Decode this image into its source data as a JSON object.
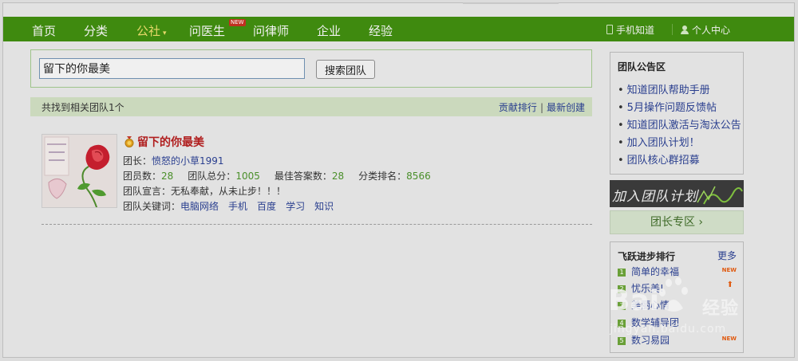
{
  "nav": {
    "items": [
      {
        "label": "首页"
      },
      {
        "label": "分类"
      },
      {
        "label": "公社"
      },
      {
        "label": "问医生"
      },
      {
        "label": "问律师"
      },
      {
        "label": "企业"
      },
      {
        "label": "经验"
      }
    ],
    "new_badge": "NEW",
    "mobile_label": "手机知道",
    "user_center_label": "个人中心",
    "active_color": "#e6d86a",
    "bar_color": "#3f8a0f"
  },
  "search": {
    "value": "留下的你最美",
    "button_label": "搜索团队"
  },
  "results": {
    "count_text": "共找到相关团队1个",
    "sort_contribution": "贡献排行",
    "sort_separator": "|",
    "sort_newest": "最新创建"
  },
  "team": {
    "name": "留下的你最美",
    "leader_label": "团长：",
    "leader_name": "愤怒的小草1991",
    "members_label": "团员数：",
    "members_value": "28",
    "score_label": "团队总分：",
    "score_value": "1005",
    "best_label": "最佳答案数：",
    "best_value": "28",
    "rank_label": "分类排名：",
    "rank_value": "8566",
    "slogan_label": "团队宣言：",
    "slogan": "无私奉献，从未止步！！！",
    "keywords_label": "团队关键词：",
    "keywords": [
      "电脑网络",
      "手机",
      "百度",
      "学习",
      "知识"
    ]
  },
  "notice": {
    "title": "团队公告区",
    "items": [
      "知道团队帮助手册",
      "5月操作问题反馈帖",
      "知道团队激活与淘汰公告",
      "加入团队计划！",
      "团队核心群招募"
    ]
  },
  "banner": {
    "text": "加入团队计划"
  },
  "leader_zone": {
    "label": "团长专区 ›"
  },
  "ranking": {
    "title": "飞跃进步排行",
    "more": "更多",
    "items": [
      {
        "num": "1",
        "name": "简单的幸福",
        "tag": "NEW"
      },
      {
        "num": "2",
        "name": "忧乐美!",
        "tag": "⬆"
      },
      {
        "num": "3",
        "name": "美丽心情",
        "tag": ""
      },
      {
        "num": "4",
        "name": "数学辅导团",
        "tag": ""
      },
      {
        "num": "5",
        "name": "数习易园",
        "tag": "NEW"
      }
    ]
  },
  "watermark": {
    "text": "经验",
    "url": "jingyan.baidu.com"
  }
}
